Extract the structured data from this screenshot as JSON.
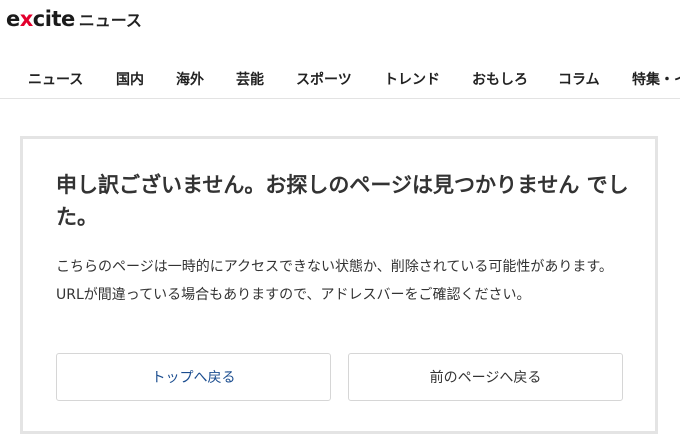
{
  "header": {
    "logo_pre": "e",
    "logo_x": "x",
    "logo_post": "cite",
    "logo_sub": "ニュース"
  },
  "nav": {
    "items": [
      "ニュース",
      "国内",
      "海外",
      "芸能",
      "スポーツ",
      "トレンド",
      "おもしろ",
      "コラム",
      "特集・イ"
    ]
  },
  "error": {
    "title": "申し訳ございません。お探しのページは見つかりません でした。",
    "message": "こちらのページは一時的にアクセスできない状態か、削除されている可能性があります。 URLが間違っている場合もありますので、アドレスバーをご確認ください。",
    "button_top": "トップへ戻る",
    "button_prev": "前のページへ戻る"
  },
  "colors": {
    "brand_red": "#e3002d",
    "link_blue": "#1b4d8f"
  }
}
